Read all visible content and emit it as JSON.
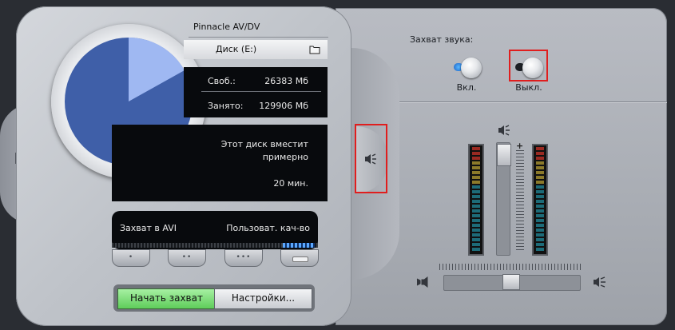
{
  "device": {
    "name": "Pinnacle AV/DV",
    "disk": "Диск (E:)"
  },
  "disk_stats": {
    "free_label": "Своб.:",
    "free_value": "26383 Мб",
    "used_label": "Занято:",
    "used_value": "129906 Мб",
    "capacity_text_line1": "Этот диск вместит",
    "capacity_text_line2": "примерно",
    "capacity_minutes": "20 мин.",
    "free_fraction": 0.169
  },
  "capture_mode": {
    "format": "Захват в AVI",
    "quality": "Пользоват. кач-во",
    "selected_preset": 4
  },
  "actions": {
    "start": "Начать захват",
    "settings": "Настройки..."
  },
  "audio": {
    "label": "Захват звука:",
    "on_label": "Вкл.",
    "off_label": "Выкл.",
    "state": "off"
  },
  "colors": {
    "disc_used": "#3f5fa8",
    "disc_free": "#9fb8f2",
    "start_button": "#6fd26a",
    "highlight": "#e01e1e"
  },
  "icons": {
    "folder": "folder-icon",
    "speaker": "speaker-icon",
    "volume": "volume-icon",
    "balance_left": "speaker-left-icon",
    "balance_right": "speaker-right-icon",
    "collapse": "collapse-icon"
  }
}
